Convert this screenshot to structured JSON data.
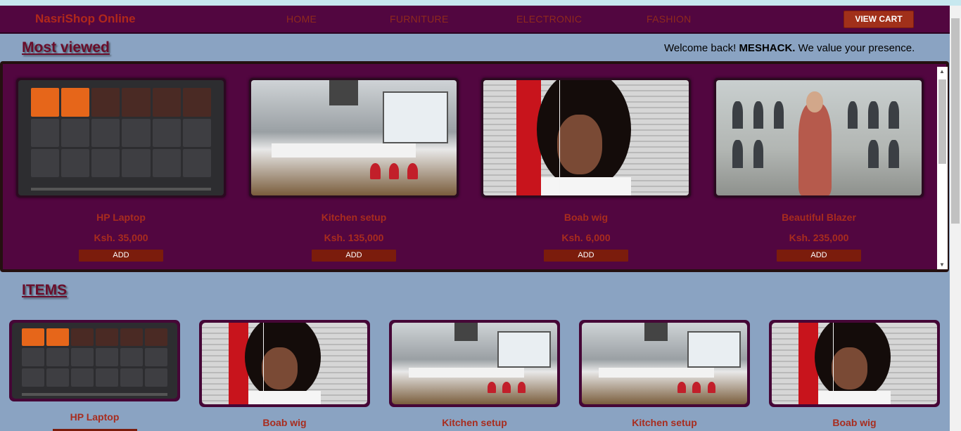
{
  "nav": {
    "brand": "NasriShop Online",
    "links": [
      "HOME",
      "FURNITURE",
      "ELECTRONIC",
      "FASHION"
    ],
    "cart_label": "VIEW CART"
  },
  "most_viewed": {
    "title": "Most viewed",
    "welcome_prefix": "Welcome back! ",
    "user": "MESHACK.",
    "welcome_suffix": " We value your presence.",
    "add_label": "ADD",
    "products": [
      {
        "name": "HP Laptop",
        "price": "Ksh. 35,000",
        "image": "laptop-app-launcher"
      },
      {
        "name": "Kitchen setup",
        "price": "Ksh. 135,000",
        "image": "kitchen"
      },
      {
        "name": "Boab wig",
        "price": "Ksh. 6,000",
        "image": "wig"
      },
      {
        "name": "Beautiful Blazer",
        "price": "Ksh. 235,000",
        "image": "blazer"
      }
    ]
  },
  "items": {
    "title": "ITEMS",
    "list": [
      {
        "name": "HP Laptop",
        "image": "laptop-app-launcher"
      },
      {
        "name": "Boab wig",
        "image": "wig"
      },
      {
        "name": "Kitchen setup",
        "image": "kitchen"
      },
      {
        "name": "Kitchen setup",
        "image": "kitchen"
      },
      {
        "name": "Boab wig",
        "image": "wig"
      }
    ]
  },
  "colors": {
    "page_bg": "#8aa3c2",
    "nav_bg": "#520640",
    "accent_red": "#a82c1e",
    "button_bg": "#7b1c0c"
  }
}
